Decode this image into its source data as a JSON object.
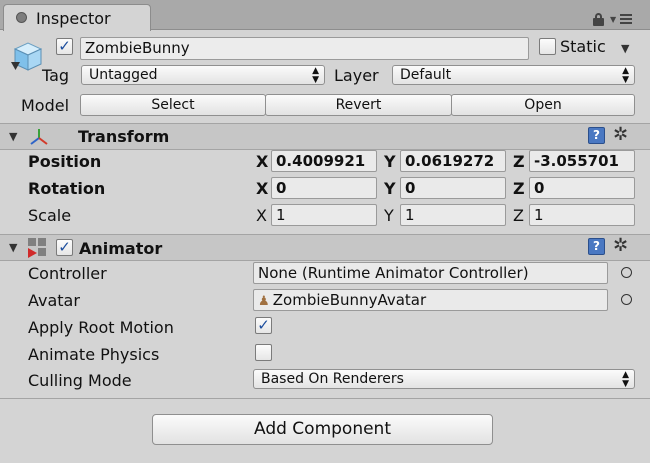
{
  "tab": {
    "title": "Inspector"
  },
  "gameobject": {
    "active": true,
    "name": "ZombieBunny",
    "static_label": "Static",
    "static_checked": false,
    "tag_label": "Tag",
    "tag_value": "Untagged",
    "layer_label": "Layer",
    "layer_value": "Default",
    "model_label": "Model",
    "model_buttons": [
      "Select",
      "Revert",
      "Open"
    ]
  },
  "transform": {
    "title": "Transform",
    "rows": [
      {
        "label": "Position",
        "x": "0.4009921",
        "y": "0.0619272",
        "z": "-3.055701"
      },
      {
        "label": "Rotation",
        "x": "0",
        "y": "0",
        "z": "0"
      },
      {
        "label": "Scale",
        "x": "1",
        "y": "1",
        "z": "1"
      }
    ],
    "axes": [
      "X",
      "Y",
      "Z"
    ]
  },
  "animator": {
    "title": "Animator",
    "enabled": true,
    "controller_label": "Controller",
    "controller_value": "None (Runtime Animator Controller)",
    "avatar_label": "Avatar",
    "avatar_value": "ZombieBunnyAvatar",
    "apply_root_motion_label": "Apply Root Motion",
    "apply_root_motion": true,
    "animate_physics_label": "Animate Physics",
    "animate_physics": false,
    "culling_mode_label": "Culling Mode",
    "culling_mode_value": "Based On Renderers"
  },
  "add_component_label": "Add Component",
  "icons": {
    "help": "?",
    "check": "✓",
    "popup_arrows": "▲▼",
    "collapse": "▼",
    "gear": "✲"
  },
  "colors": {
    "background": "#d4d4d4",
    "check": "#1d4e9e",
    "help": "#4a78c2"
  }
}
